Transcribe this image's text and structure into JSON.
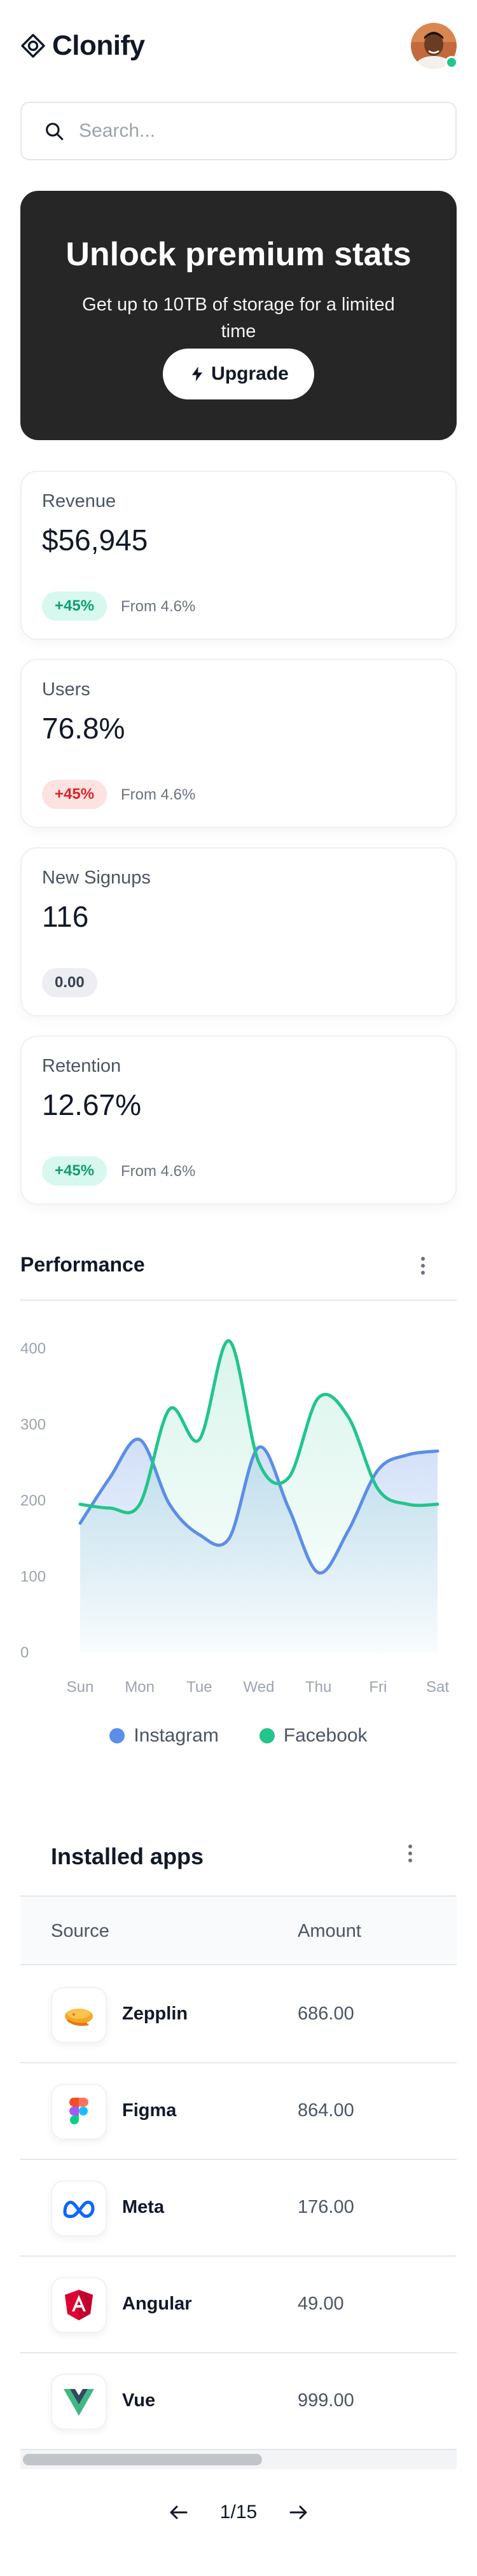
{
  "app": {
    "brand": "Clonify"
  },
  "search": {
    "placeholder": "Search..."
  },
  "promo": {
    "title": "Unlock premium stats",
    "subtitle": "Get up to 10TB of storage for a limited time",
    "button_label": "Upgrade"
  },
  "stats": [
    {
      "label": "Revenue",
      "value": "$56,945",
      "badge": "+45%",
      "badge_color": "green",
      "note": "From 4.6%"
    },
    {
      "label": "Users",
      "value": "76.8%",
      "badge": "+45%",
      "badge_color": "red",
      "note": "From 4.6%"
    },
    {
      "label": "New Signups",
      "value": "116",
      "badge": "0.00",
      "badge_color": "gray",
      "note": ""
    },
    {
      "label": "Retention",
      "value": "12.67%",
      "badge": "+45%",
      "badge_color": "green",
      "note": "From 4.6%"
    }
  ],
  "performance": {
    "title": "Performance"
  },
  "chart_data": {
    "type": "line",
    "categories": [
      "Sun",
      "Mon",
      "Tue",
      "Wed",
      "Thu",
      "Fri",
      "Sat"
    ],
    "x": [
      0,
      0.5,
      1,
      1.5,
      2,
      2.5,
      3,
      3.5,
      4,
      4.5,
      5,
      5.5,
      6
    ],
    "ylim": [
      0,
      400
    ],
    "yticks": [
      0,
      100,
      200,
      300,
      400
    ],
    "grid": false,
    "series": [
      {
        "name": "Instagram",
        "color": "#5b8ee6",
        "area": true,
        "values": [
          170,
          230,
          280,
          195,
          155,
          150,
          270,
          190,
          105,
          160,
          240,
          260,
          265
        ]
      },
      {
        "name": "Facebook",
        "color": "#22c58b",
        "area": true,
        "values": [
          195,
          190,
          195,
          320,
          280,
          410,
          250,
          230,
          335,
          310,
          215,
          195,
          195
        ]
      }
    ]
  },
  "apps": {
    "title": "Installed apps",
    "columns": [
      "Source",
      "Amount"
    ],
    "rows": [
      {
        "name": "Zepplin",
        "amount": "686.00",
        "icon": "zeplin-icon"
      },
      {
        "name": "Figma",
        "amount": "864.00",
        "icon": "figma-icon"
      },
      {
        "name": "Meta",
        "amount": "176.00",
        "icon": "meta-icon"
      },
      {
        "name": "Angular",
        "amount": "49.00",
        "icon": "angular-icon"
      },
      {
        "name": "Vue",
        "amount": "999.00",
        "icon": "vue-icon"
      }
    ]
  },
  "pagination": {
    "text": "1/15"
  },
  "colors": {
    "primary_dark": "#262626",
    "green": "#22c58b",
    "blue": "#5b8ee6",
    "red": "#dc2626"
  }
}
